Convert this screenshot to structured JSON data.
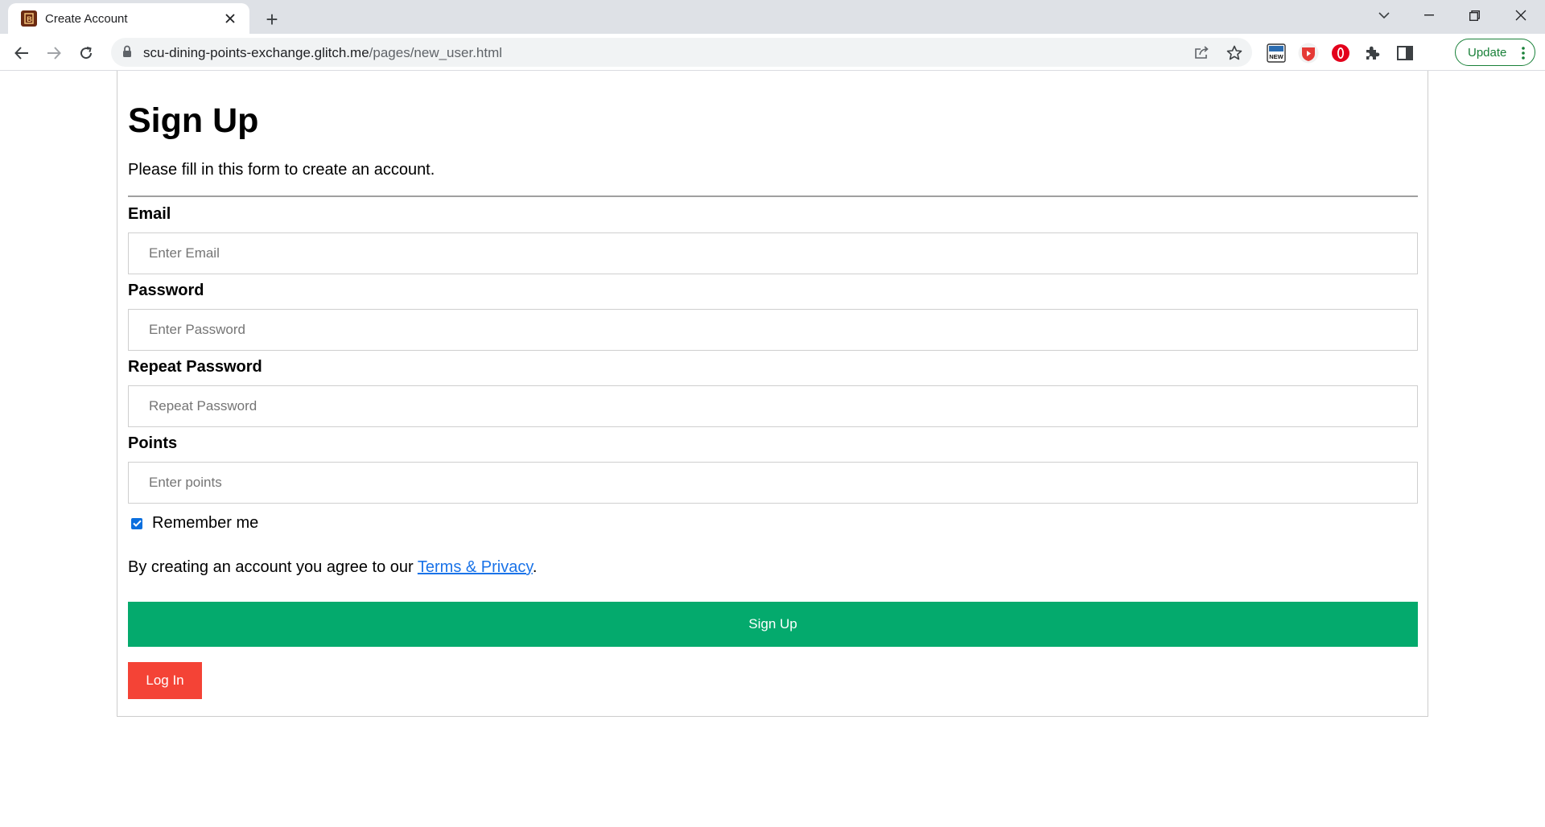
{
  "browser": {
    "tab_title": "Create Account",
    "new_tab_symbol": "+",
    "url_host": "scu-dining-points-exchange.glitch.me",
    "url_path": "/pages/new_user.html",
    "update_label": "Update",
    "extension_new_label": "NEW"
  },
  "form": {
    "title": "Sign Up",
    "subtitle": "Please fill in this form to create an account.",
    "fields": [
      {
        "label": "Email",
        "placeholder": "Enter Email"
      },
      {
        "label": "Password",
        "placeholder": "Enter Password"
      },
      {
        "label": "Repeat Password",
        "placeholder": "Repeat Password"
      },
      {
        "label": "Points",
        "placeholder": "Enter points"
      }
    ],
    "remember_label": "Remember me",
    "remember_checked": true,
    "agree_prefix": "By creating an account you agree to our ",
    "agree_link": "Terms & Privacy",
    "agree_suffix": ".",
    "signup_label": "Sign Up",
    "login_label": "Log In"
  },
  "colors": {
    "signup_green": "#04aa6d",
    "login_red": "#f44336",
    "link_blue": "#1a73e8",
    "update_green": "#188038"
  }
}
